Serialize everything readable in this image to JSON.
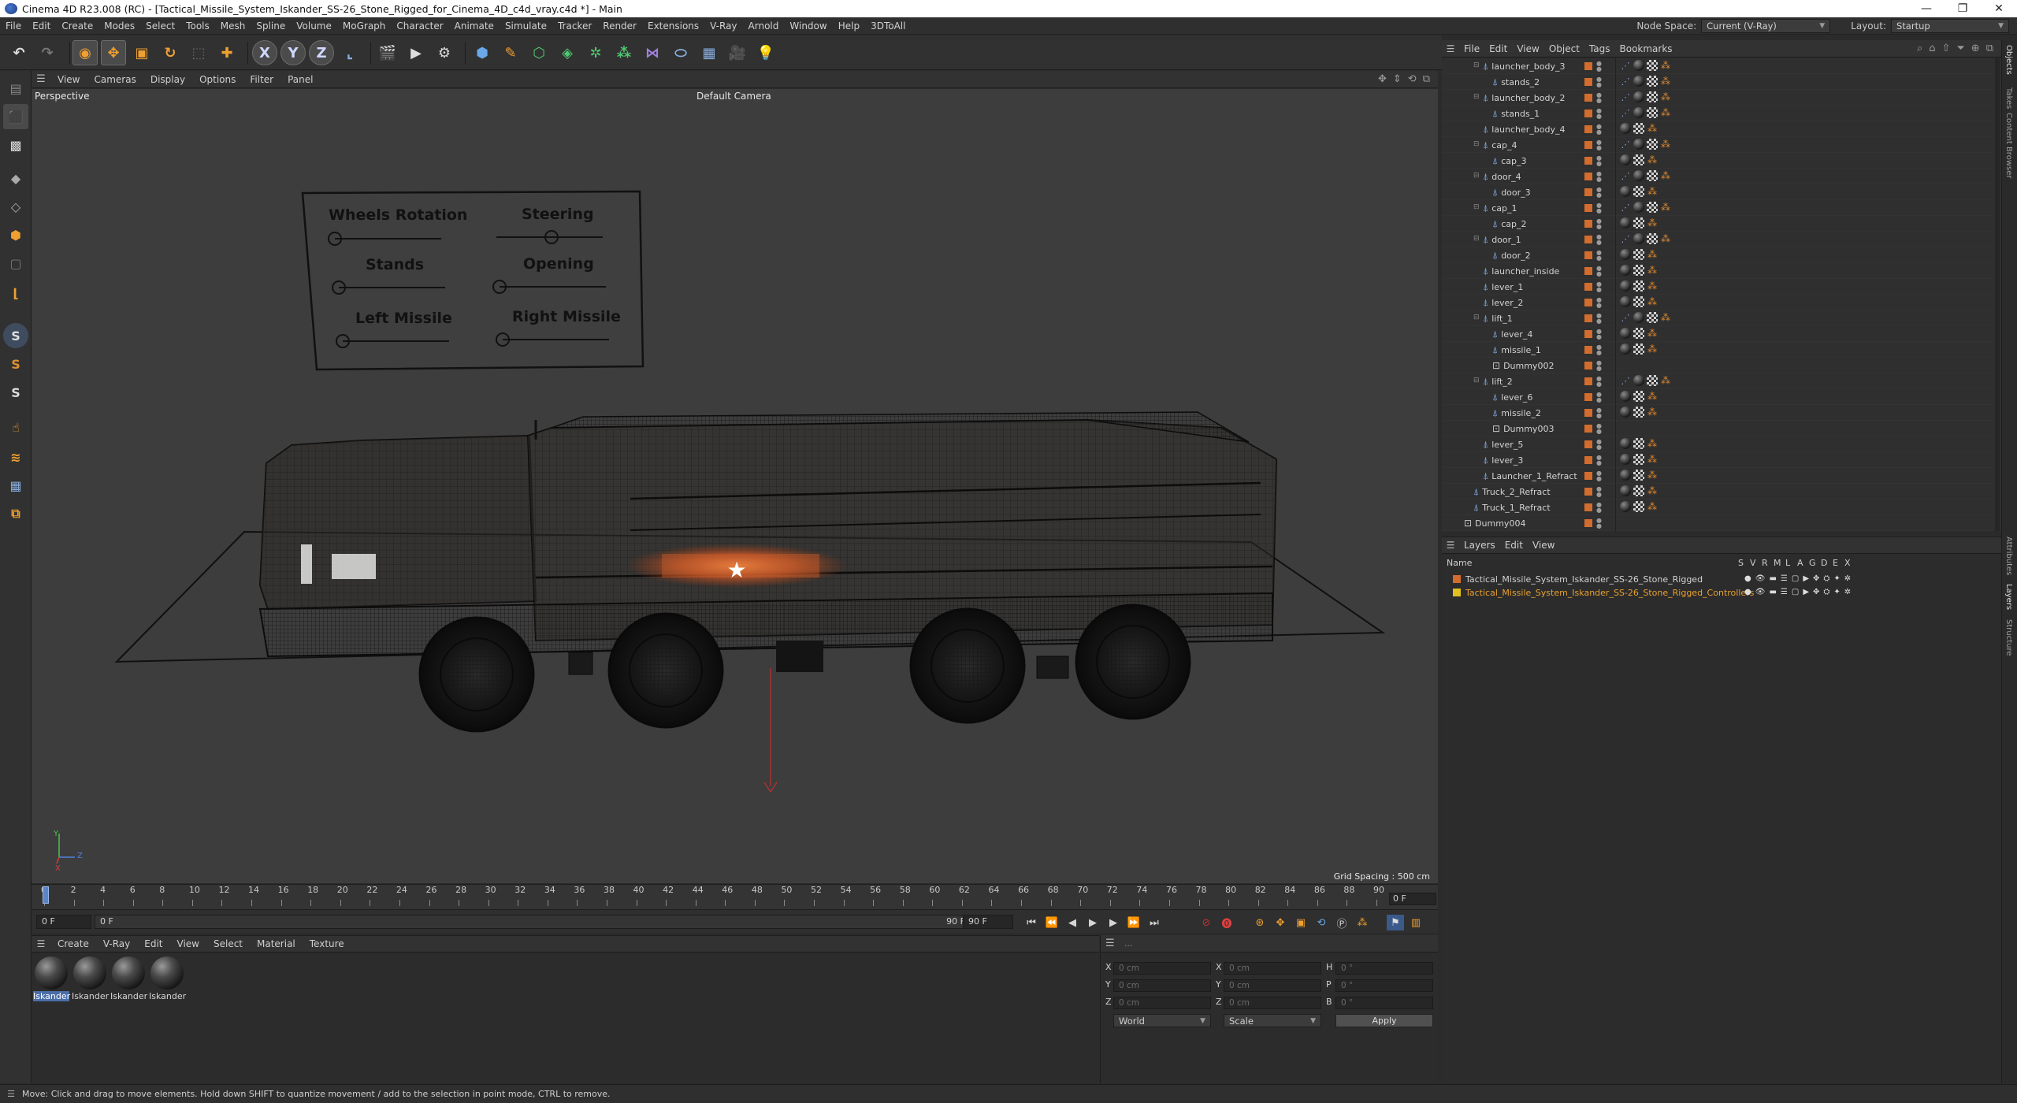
{
  "window": {
    "title": "Cinema 4D R23.008 (RC) - [Tactical_Missile_System_Iskander_SS-26_Stone_Rigged_for_Cinema_4D_c4d_vray.c4d *] - Main",
    "controls": [
      "—",
      "❐",
      "✕"
    ]
  },
  "menubar": {
    "items": [
      "File",
      "Edit",
      "Create",
      "Modes",
      "Select",
      "Tools",
      "Mesh",
      "Spline",
      "Volume",
      "MoGraph",
      "Character",
      "Animate",
      "Simulate",
      "Tracker",
      "Render",
      "Extensions",
      "V-Ray",
      "Arnold",
      "Window",
      "Help",
      "3DToAll"
    ],
    "node_space_label": "Node Space:",
    "node_space_value": "Current (V-Ray)",
    "layout_label": "Layout:",
    "layout_value": "Startup"
  },
  "toolbar": {
    "undo_icon": "undo-icon",
    "redo_icon": "redo-icon",
    "axis_x": "X",
    "axis_y": "Y",
    "axis_z": "Z"
  },
  "viewport": {
    "menu": [
      "View",
      "Cameras",
      "Display",
      "Options",
      "Filter",
      "Panel"
    ],
    "projection": "Perspective",
    "camera": "Default Camera",
    "grid_spacing": "Grid Spacing : 500 cm",
    "controller_labels": [
      "Wheels Rotation",
      "Steering",
      "Stands",
      "Opening",
      "Left Missile",
      "Right Missile"
    ],
    "axis_y": "Y",
    "axis_z": "Z",
    "axis_x": "X"
  },
  "timeline": {
    "ticks": [
      "0",
      "2",
      "4",
      "6",
      "8",
      "10",
      "12",
      "14",
      "16",
      "18",
      "20",
      "22",
      "24",
      "26",
      "28",
      "30",
      "32",
      "34",
      "36",
      "38",
      "40",
      "42",
      "44",
      "46",
      "48",
      "50",
      "52",
      "54",
      "56",
      "58",
      "60",
      "62",
      "64",
      "66",
      "68",
      "70",
      "72",
      "74",
      "76",
      "78",
      "80",
      "82",
      "84",
      "86",
      "88",
      "90"
    ],
    "current_frame_field": "0 F",
    "start_field": "0 F",
    "slider_start": "0 F",
    "slider_end": "90 F",
    "end_field": "90 F"
  },
  "materials": {
    "menu": [
      "Create",
      "V-Ray",
      "Edit",
      "View",
      "Select",
      "Material",
      "Texture"
    ],
    "items": [
      "Iskander",
      "Iskander",
      "Iskander",
      "Iskander"
    ]
  },
  "coordinates": {
    "header_dots": "...",
    "rows": [
      {
        "axis": "X",
        "pos": "0 cm",
        "axis2": "X",
        "size": "0 cm",
        "rot_label": "H",
        "rot": "0 °"
      },
      {
        "axis": "Y",
        "pos": "0 cm",
        "axis2": "Y",
        "size": "0 cm",
        "rot_label": "P",
        "rot": "0 °"
      },
      {
        "axis": "Z",
        "pos": "0 cm",
        "axis2": "Z",
        "size": "0 cm",
        "rot_label": "B",
        "rot": "0 °"
      }
    ],
    "mode": "World",
    "scale_mode": "Scale",
    "apply": "Apply"
  },
  "object_manager": {
    "menu": [
      "File",
      "Edit",
      "View",
      "Object",
      "Tags",
      "Bookmarks"
    ],
    "rows": [
      {
        "name": "launcher_body_3",
        "level": 1,
        "icon": "bone"
      },
      {
        "name": "stands_2",
        "level": 2,
        "icon": "bone"
      },
      {
        "name": "launcher_body_2",
        "level": 1,
        "icon": "bone"
      },
      {
        "name": "stands_1",
        "level": 2,
        "icon": "bone"
      },
      {
        "name": "launcher_body_4",
        "level": 1,
        "icon": "bone"
      },
      {
        "name": "cap_4",
        "level": 1,
        "icon": "bone"
      },
      {
        "name": "cap_3",
        "level": 2,
        "icon": "bone"
      },
      {
        "name": "door_4",
        "level": 1,
        "icon": "bone"
      },
      {
        "name": "door_3",
        "level": 2,
        "icon": "bone"
      },
      {
        "name": "cap_1",
        "level": 1,
        "icon": "bone"
      },
      {
        "name": "cap_2",
        "level": 2,
        "icon": "bone"
      },
      {
        "name": "door_1",
        "level": 1,
        "icon": "bone"
      },
      {
        "name": "door_2",
        "level": 2,
        "icon": "bone"
      },
      {
        "name": "launcher_inside",
        "level": 1,
        "icon": "bone"
      },
      {
        "name": "lever_1",
        "level": 1,
        "icon": "bone"
      },
      {
        "name": "lever_2",
        "level": 1,
        "icon": "bone"
      },
      {
        "name": "lift_1",
        "level": 1,
        "icon": "bone"
      },
      {
        "name": "lever_4",
        "level": 2,
        "icon": "bone"
      },
      {
        "name": "missile_1",
        "level": 2,
        "icon": "bone"
      },
      {
        "name": "Dummy002",
        "level": 2,
        "icon": "null"
      },
      {
        "name": "lift_2",
        "level": 1,
        "icon": "bone"
      },
      {
        "name": "lever_6",
        "level": 2,
        "icon": "bone"
      },
      {
        "name": "missile_2",
        "level": 2,
        "icon": "bone"
      },
      {
        "name": "Dummy003",
        "level": 2,
        "icon": "null"
      },
      {
        "name": "lever_5",
        "level": 1,
        "icon": "bone"
      },
      {
        "name": "lever_3",
        "level": 1,
        "icon": "bone"
      },
      {
        "name": "Launcher_1_Refract",
        "level": 1,
        "icon": "bone"
      },
      {
        "name": "Truck_2_Refract",
        "level": 0,
        "icon": "bone"
      },
      {
        "name": "Truck_1_Refract",
        "level": 0,
        "icon": "bone"
      },
      {
        "name": "Dummy004",
        "level": -1,
        "icon": "null"
      }
    ]
  },
  "layer_manager": {
    "menu": [
      "Layers",
      "Edit",
      "View"
    ],
    "columns": [
      "Name",
      "S",
      "V",
      "R",
      "M",
      "L",
      "A",
      "G",
      "D",
      "E",
      "X"
    ],
    "layers": [
      {
        "name": "Tactical_Missile_System_Iskander_SS-26_Stone_Rigged",
        "color": "#d26d2d",
        "text_color": "#d2d2d2"
      },
      {
        "name": "Tactical_Missile_System_Iskander_SS-26_Stone_Rigged_Controllers",
        "color": "#e0c020",
        "text_color": "#e8a030"
      }
    ]
  },
  "right_tabs": [
    "Objects",
    "Takes",
    "Content Browser",
    "Attributes",
    "Layers",
    "Structure"
  ],
  "statusbar": {
    "text": "Move: Click and drag to move elements. Hold down SHIFT to quantize movement / add to the selection in point mode, CTRL to remove."
  }
}
